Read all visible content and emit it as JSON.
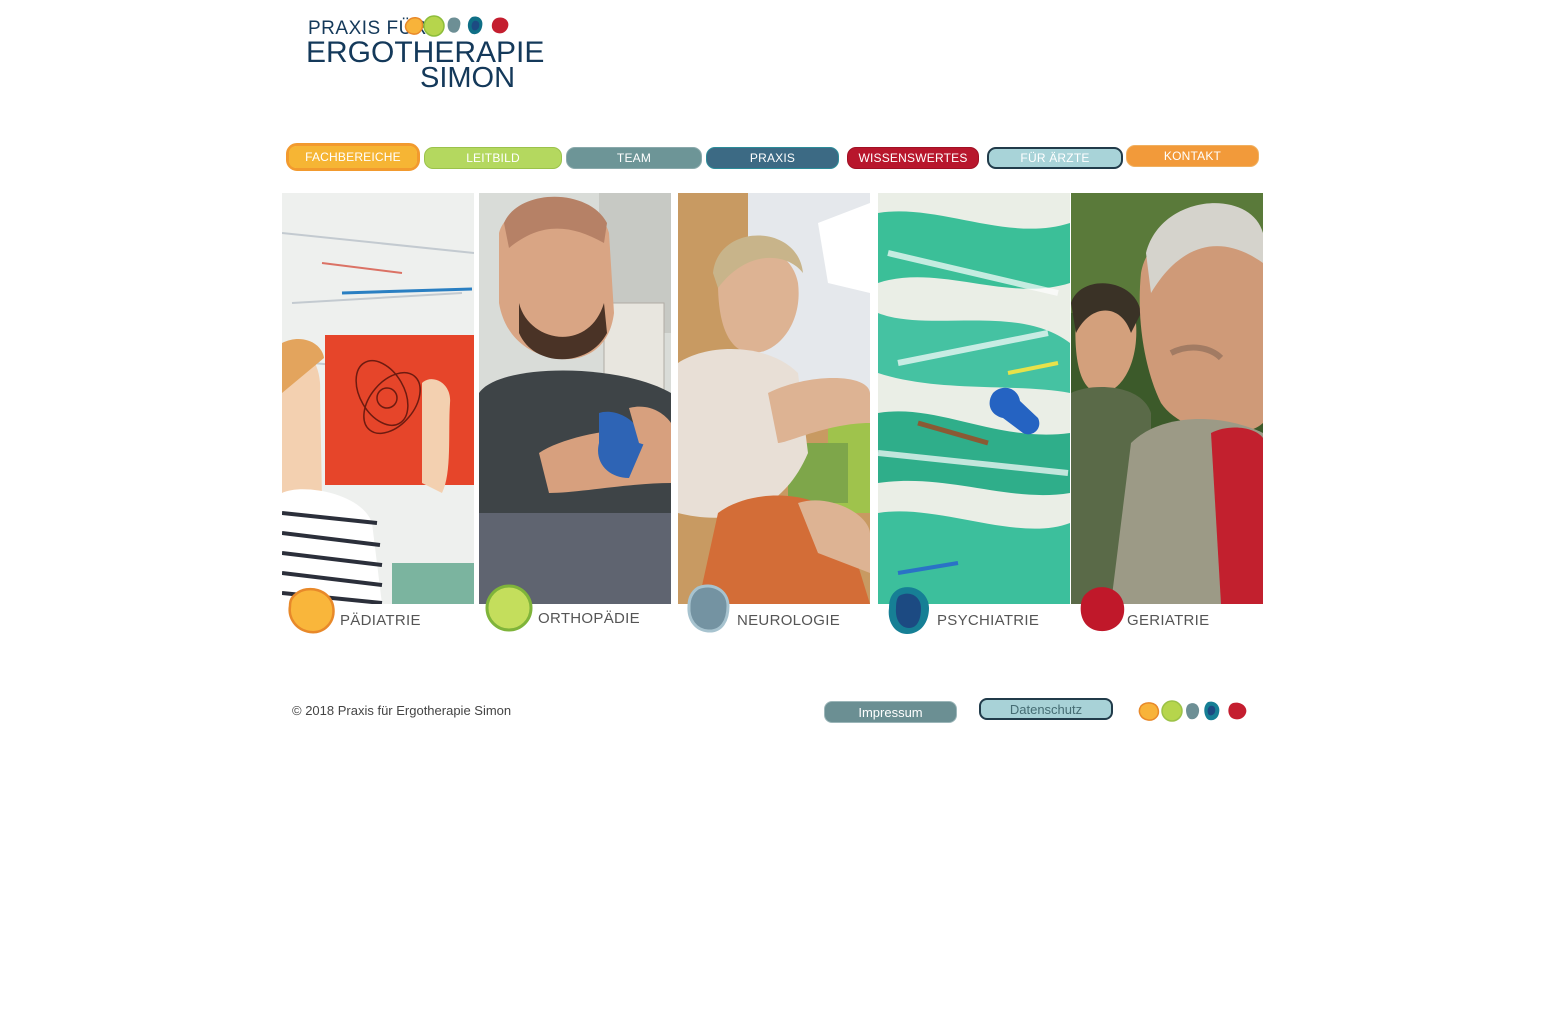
{
  "logo": {
    "line1": "PRAXIS FÜR",
    "line2": "ERGOTHERAPIE",
    "line3": "SIMON",
    "colors": [
      "#f8b33a",
      "#b6d54c",
      "#6d8f95",
      "#0f6f86",
      "#c41e2f"
    ]
  },
  "nav": {
    "items": [
      {
        "label": "FACHBEREICHE",
        "color": "#f6b534",
        "active": true
      },
      {
        "label": "LEITBILD",
        "color": "#b4d85f",
        "active": false
      },
      {
        "label": "TEAM",
        "color": "#6d9597",
        "active": false
      },
      {
        "label": "PRAXIS",
        "color": "#3c6a84",
        "active": false
      },
      {
        "label": "WISSENSWERTES",
        "color": "#b8162c",
        "active": false
      },
      {
        "label": "FÜR ÄRZTE",
        "color": "#a8d3d8",
        "active": false
      },
      {
        "label": "KONTAKT",
        "color": "#f29a3a",
        "active": false
      }
    ]
  },
  "categories": [
    {
      "label": "PÄDIATRIE",
      "icon": "orange-blob-icon",
      "color": "#f9b63b",
      "stroke": "#e8892a"
    },
    {
      "label": "ORTHOPÄDIE",
      "icon": "green-blob-icon",
      "color": "#c4de5c",
      "stroke": "#7fb43a"
    },
    {
      "label": "NEUROLOGIE",
      "icon": "grey-blue-blob-icon",
      "color": "#7493a2",
      "stroke": "#a7c3cf"
    },
    {
      "label": "PSYCHIATRIE",
      "icon": "navy-blob-icon",
      "color": "#1c4a82",
      "stroke": "#167f95"
    },
    {
      "label": "GERIATRIE",
      "icon": "red-blob-icon",
      "color": "#c0182a",
      "stroke": "#c0182a"
    }
  ],
  "footer": {
    "copyright": "© 2018 Praxis für Ergotherapie Simon",
    "impressum": "Impressum",
    "datenschutz": "Datenschutz"
  }
}
